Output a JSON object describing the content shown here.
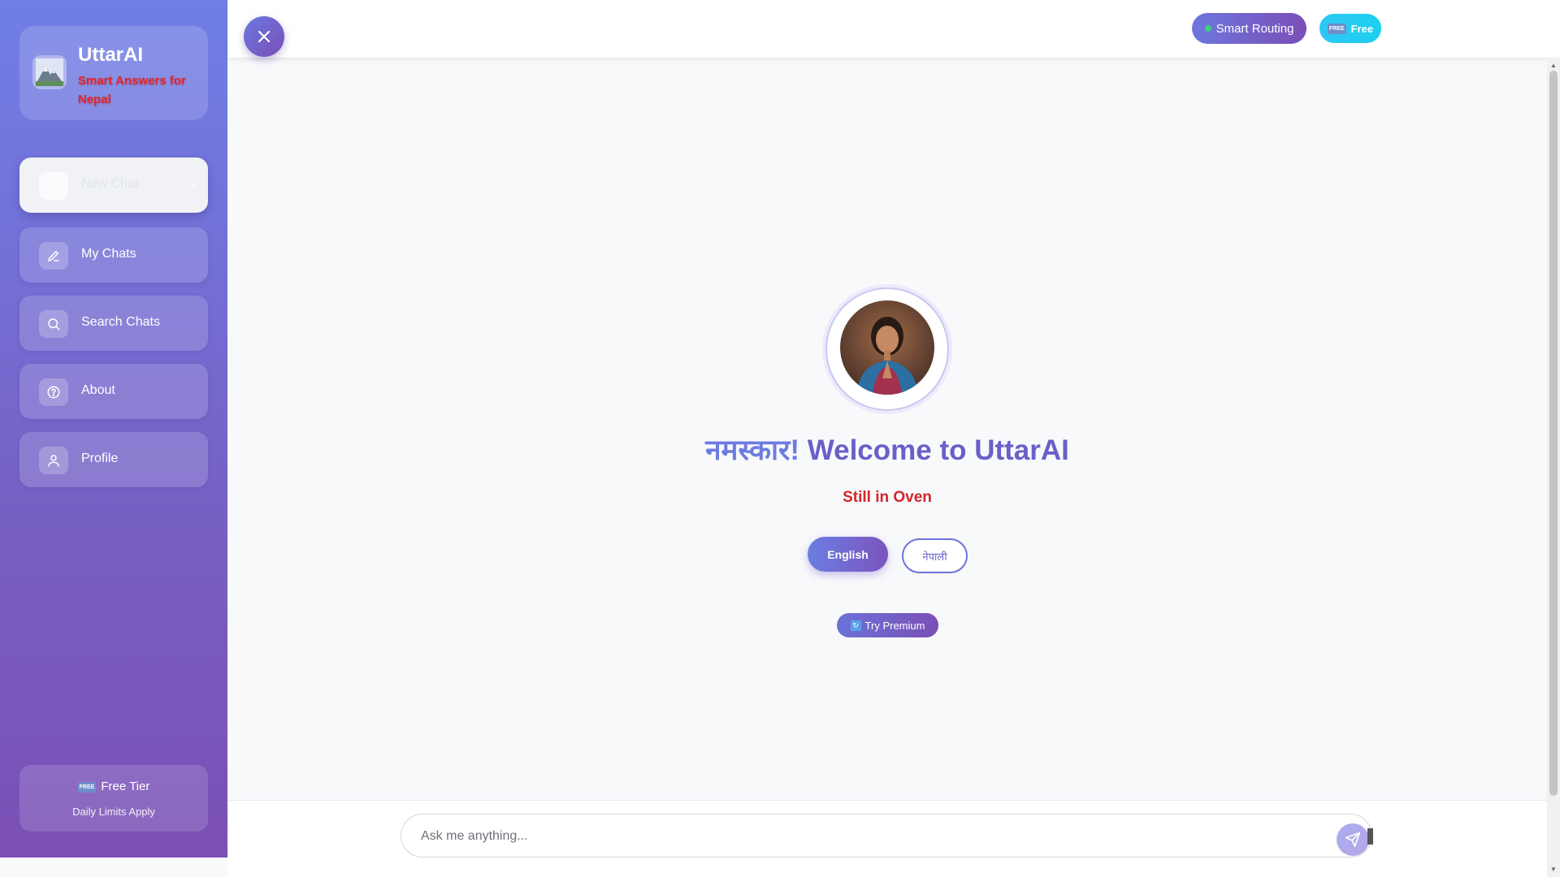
{
  "brand": {
    "title": "UttarAI",
    "subtitle": "Smart Answers for Nepal",
    "logo_icon": "mountain-logo-icon"
  },
  "nav": {
    "items": [
      {
        "label": "New Chat",
        "icon": "chat-bubble-icon",
        "active": true
      },
      {
        "label": "My Chats",
        "icon": "pencil-icon"
      },
      {
        "label": "Search Chats",
        "icon": "search-icon"
      },
      {
        "label": "About",
        "icon": "help-circle-icon"
      },
      {
        "label": "Profile",
        "icon": "user-icon"
      }
    ]
  },
  "tier": {
    "title": "Free Tier",
    "subtitle": "Daily Limits Apply",
    "badge_glyph": "FREE"
  },
  "topbar": {
    "routing_label": "Smart Routing",
    "free_label": "Free",
    "free_glyph": "FREE"
  },
  "main": {
    "welcome_dev": "नमस्कार!",
    "welcome_rest": " Welcome to UttarAI",
    "tagline": "Still in Oven",
    "lang_english": "English",
    "lang_nepali": "नेपाली",
    "premium_label": "Try Premium"
  },
  "input": {
    "placeholder": "Ask me anything...",
    "value": ""
  },
  "colors": {
    "sidebar_top": "#6f7fe6",
    "sidebar_bottom": "#7b4fb4",
    "accent_purple": "#6a5fc9",
    "tagline_red": "#d3262b",
    "free_cyan": "#1bd0ee"
  }
}
